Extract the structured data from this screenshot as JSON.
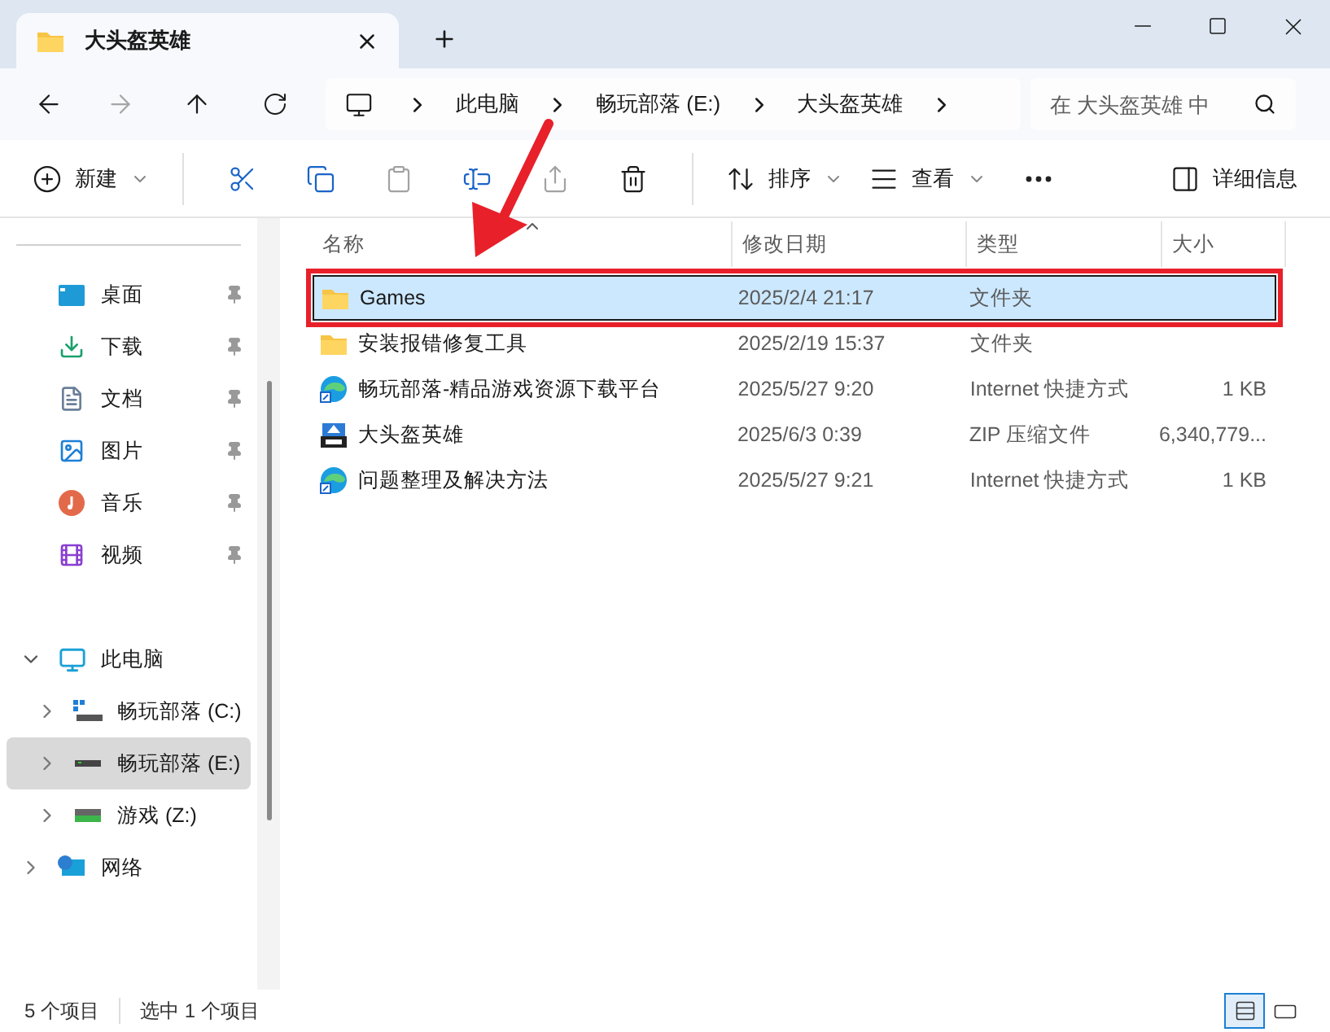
{
  "window": {
    "title": "大头盔英雄"
  },
  "address": {
    "segments": [
      "此电脑",
      "畅玩部落 (E:)",
      "大头盔英雄"
    ]
  },
  "search": {
    "placeholder": "在 大头盔英雄 中"
  },
  "toolbar": [
    {
      "kind": "new",
      "label": "新建",
      "disabled": false
    },
    {
      "kind": "cut",
      "disabled": false
    },
    {
      "kind": "copy",
      "disabled": false
    },
    {
      "kind": "paste",
      "disabled": true
    },
    {
      "kind": "rename",
      "disabled": false
    },
    {
      "kind": "share",
      "disabled": true
    },
    {
      "kind": "delete",
      "disabled": false
    },
    {
      "kind": "sort",
      "label": "排序",
      "disabled": false
    },
    {
      "kind": "view",
      "label": "查看",
      "disabled": false
    },
    {
      "kind": "more",
      "disabled": false
    },
    {
      "kind": "details",
      "label": "详细信息",
      "disabled": false
    }
  ],
  "quick_access": [
    {
      "label": "桌面",
      "kind": "desktop",
      "pinned": true
    },
    {
      "label": "下载",
      "kind": "download",
      "pinned": true
    },
    {
      "label": "文档",
      "kind": "document",
      "pinned": true
    },
    {
      "label": "图片",
      "kind": "pictures",
      "pinned": true
    },
    {
      "label": "音乐",
      "kind": "music",
      "pinned": true
    },
    {
      "label": "视频",
      "kind": "video",
      "pinned": true
    }
  ],
  "tree": [
    {
      "label": "此电脑",
      "kind": "pc",
      "expanded": true,
      "selected": false,
      "children": [
        {
          "label": "畅玩部落 (C:)",
          "kind": "systemdrive",
          "expanded": false,
          "selected": false
        },
        {
          "label": "畅玩部落 (E:)",
          "kind": "drive",
          "expanded": false,
          "selected": true
        },
        {
          "label": "游戏 (Z:)",
          "kind": "gamedrive",
          "expanded": false,
          "selected": false
        }
      ]
    },
    {
      "label": "网络",
      "kind": "network",
      "expanded": false,
      "selected": false
    }
  ],
  "table": {
    "columns": [
      {
        "label": "名称",
        "sorted": true
      },
      {
        "label": "修改日期",
        "sorted": false
      },
      {
        "label": "类型",
        "sorted": false
      },
      {
        "label": "大小",
        "sorted": false
      }
    ],
    "rows": [
      {
        "kind": "folder",
        "name": "Games",
        "date": "2025/2/4 21:17",
        "type": "文件夹",
        "size": "",
        "selected": true,
        "highlighted": true
      },
      {
        "kind": "folder",
        "name": "安装报错修复工具",
        "date": "2025/2/19 15:37",
        "type": "文件夹",
        "size": "",
        "selected": false,
        "highlighted": false
      },
      {
        "kind": "shortcut",
        "name": "畅玩部落-精品游戏资源下载平台",
        "date": "2025/5/27 9:20",
        "type": "Internet 快捷方式",
        "size": "1 KB",
        "selected": false,
        "highlighted": false
      },
      {
        "kind": "zip",
        "name": "大头盔英雄",
        "date": "2025/6/3 0:39",
        "type": "ZIP 压缩文件",
        "size": "6,340,779...",
        "selected": false,
        "highlighted": false
      },
      {
        "kind": "shortcut",
        "name": "问题整理及解决方法",
        "date": "2025/5/27 9:21",
        "type": "Internet 快捷方式",
        "size": "1 KB",
        "selected": false,
        "highlighted": false
      }
    ]
  },
  "annotation": {
    "arrow": true
  },
  "status_bar": {
    "items": [
      "5 个项目",
      "选中 1 个项目"
    ],
    "views": [
      {
        "kind": "details",
        "selected": true
      },
      {
        "kind": "tiles",
        "selected": false
      }
    ]
  }
}
